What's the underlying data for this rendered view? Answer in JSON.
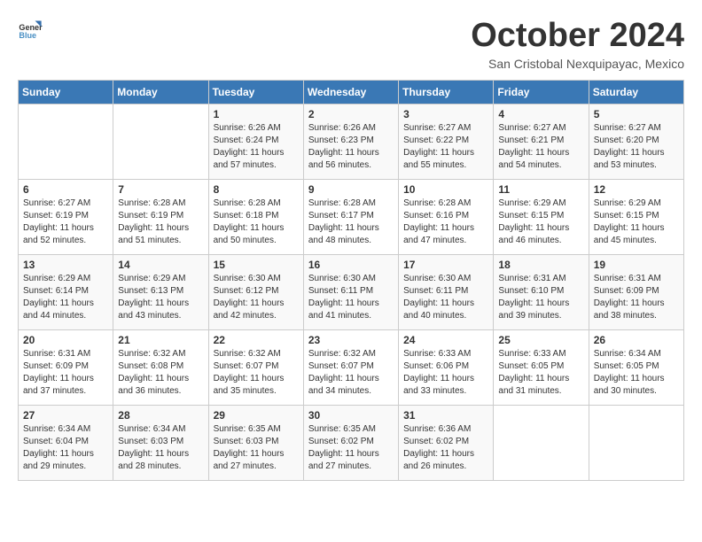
{
  "logo": {
    "general": "General",
    "blue": "Blue"
  },
  "title": "October 2024",
  "subtitle": "San Cristobal Nexquipayac, Mexico",
  "headers": [
    "Sunday",
    "Monday",
    "Tuesday",
    "Wednesday",
    "Thursday",
    "Friday",
    "Saturday"
  ],
  "weeks": [
    [
      {
        "day": "",
        "info": ""
      },
      {
        "day": "",
        "info": ""
      },
      {
        "day": "1",
        "sunrise": "6:26 AM",
        "sunset": "6:24 PM",
        "daylight": "11 hours and 57 minutes."
      },
      {
        "day": "2",
        "sunrise": "6:26 AM",
        "sunset": "6:23 PM",
        "daylight": "11 hours and 56 minutes."
      },
      {
        "day": "3",
        "sunrise": "6:27 AM",
        "sunset": "6:22 PM",
        "daylight": "11 hours and 55 minutes."
      },
      {
        "day": "4",
        "sunrise": "6:27 AM",
        "sunset": "6:21 PM",
        "daylight": "11 hours and 54 minutes."
      },
      {
        "day": "5",
        "sunrise": "6:27 AM",
        "sunset": "6:20 PM",
        "daylight": "11 hours and 53 minutes."
      }
    ],
    [
      {
        "day": "6",
        "sunrise": "6:27 AM",
        "sunset": "6:19 PM",
        "daylight": "11 hours and 52 minutes."
      },
      {
        "day": "7",
        "sunrise": "6:28 AM",
        "sunset": "6:19 PM",
        "daylight": "11 hours and 51 minutes."
      },
      {
        "day": "8",
        "sunrise": "6:28 AM",
        "sunset": "6:18 PM",
        "daylight": "11 hours and 50 minutes."
      },
      {
        "day": "9",
        "sunrise": "6:28 AM",
        "sunset": "6:17 PM",
        "daylight": "11 hours and 48 minutes."
      },
      {
        "day": "10",
        "sunrise": "6:28 AM",
        "sunset": "6:16 PM",
        "daylight": "11 hours and 47 minutes."
      },
      {
        "day": "11",
        "sunrise": "6:29 AM",
        "sunset": "6:15 PM",
        "daylight": "11 hours and 46 minutes."
      },
      {
        "day": "12",
        "sunrise": "6:29 AM",
        "sunset": "6:15 PM",
        "daylight": "11 hours and 45 minutes."
      }
    ],
    [
      {
        "day": "13",
        "sunrise": "6:29 AM",
        "sunset": "6:14 PM",
        "daylight": "11 hours and 44 minutes."
      },
      {
        "day": "14",
        "sunrise": "6:29 AM",
        "sunset": "6:13 PM",
        "daylight": "11 hours and 43 minutes."
      },
      {
        "day": "15",
        "sunrise": "6:30 AM",
        "sunset": "6:12 PM",
        "daylight": "11 hours and 42 minutes."
      },
      {
        "day": "16",
        "sunrise": "6:30 AM",
        "sunset": "6:11 PM",
        "daylight": "11 hours and 41 minutes."
      },
      {
        "day": "17",
        "sunrise": "6:30 AM",
        "sunset": "6:11 PM",
        "daylight": "11 hours and 40 minutes."
      },
      {
        "day": "18",
        "sunrise": "6:31 AM",
        "sunset": "6:10 PM",
        "daylight": "11 hours and 39 minutes."
      },
      {
        "day": "19",
        "sunrise": "6:31 AM",
        "sunset": "6:09 PM",
        "daylight": "11 hours and 38 minutes."
      }
    ],
    [
      {
        "day": "20",
        "sunrise": "6:31 AM",
        "sunset": "6:09 PM",
        "daylight": "11 hours and 37 minutes."
      },
      {
        "day": "21",
        "sunrise": "6:32 AM",
        "sunset": "6:08 PM",
        "daylight": "11 hours and 36 minutes."
      },
      {
        "day": "22",
        "sunrise": "6:32 AM",
        "sunset": "6:07 PM",
        "daylight": "11 hours and 35 minutes."
      },
      {
        "day": "23",
        "sunrise": "6:32 AM",
        "sunset": "6:07 PM",
        "daylight": "11 hours and 34 minutes."
      },
      {
        "day": "24",
        "sunrise": "6:33 AM",
        "sunset": "6:06 PM",
        "daylight": "11 hours and 33 minutes."
      },
      {
        "day": "25",
        "sunrise": "6:33 AM",
        "sunset": "6:05 PM",
        "daylight": "11 hours and 31 minutes."
      },
      {
        "day": "26",
        "sunrise": "6:34 AM",
        "sunset": "6:05 PM",
        "daylight": "11 hours and 30 minutes."
      }
    ],
    [
      {
        "day": "27",
        "sunrise": "6:34 AM",
        "sunset": "6:04 PM",
        "daylight": "11 hours and 29 minutes."
      },
      {
        "day": "28",
        "sunrise": "6:34 AM",
        "sunset": "6:03 PM",
        "daylight": "11 hours and 28 minutes."
      },
      {
        "day": "29",
        "sunrise": "6:35 AM",
        "sunset": "6:03 PM",
        "daylight": "11 hours and 27 minutes."
      },
      {
        "day": "30",
        "sunrise": "6:35 AM",
        "sunset": "6:02 PM",
        "daylight": "11 hours and 27 minutes."
      },
      {
        "day": "31",
        "sunrise": "6:36 AM",
        "sunset": "6:02 PM",
        "daylight": "11 hours and 26 minutes."
      },
      {
        "day": "",
        "info": ""
      },
      {
        "day": "",
        "info": ""
      }
    ]
  ],
  "labels": {
    "sunrise": "Sunrise:",
    "sunset": "Sunset:",
    "daylight": "Daylight:"
  }
}
